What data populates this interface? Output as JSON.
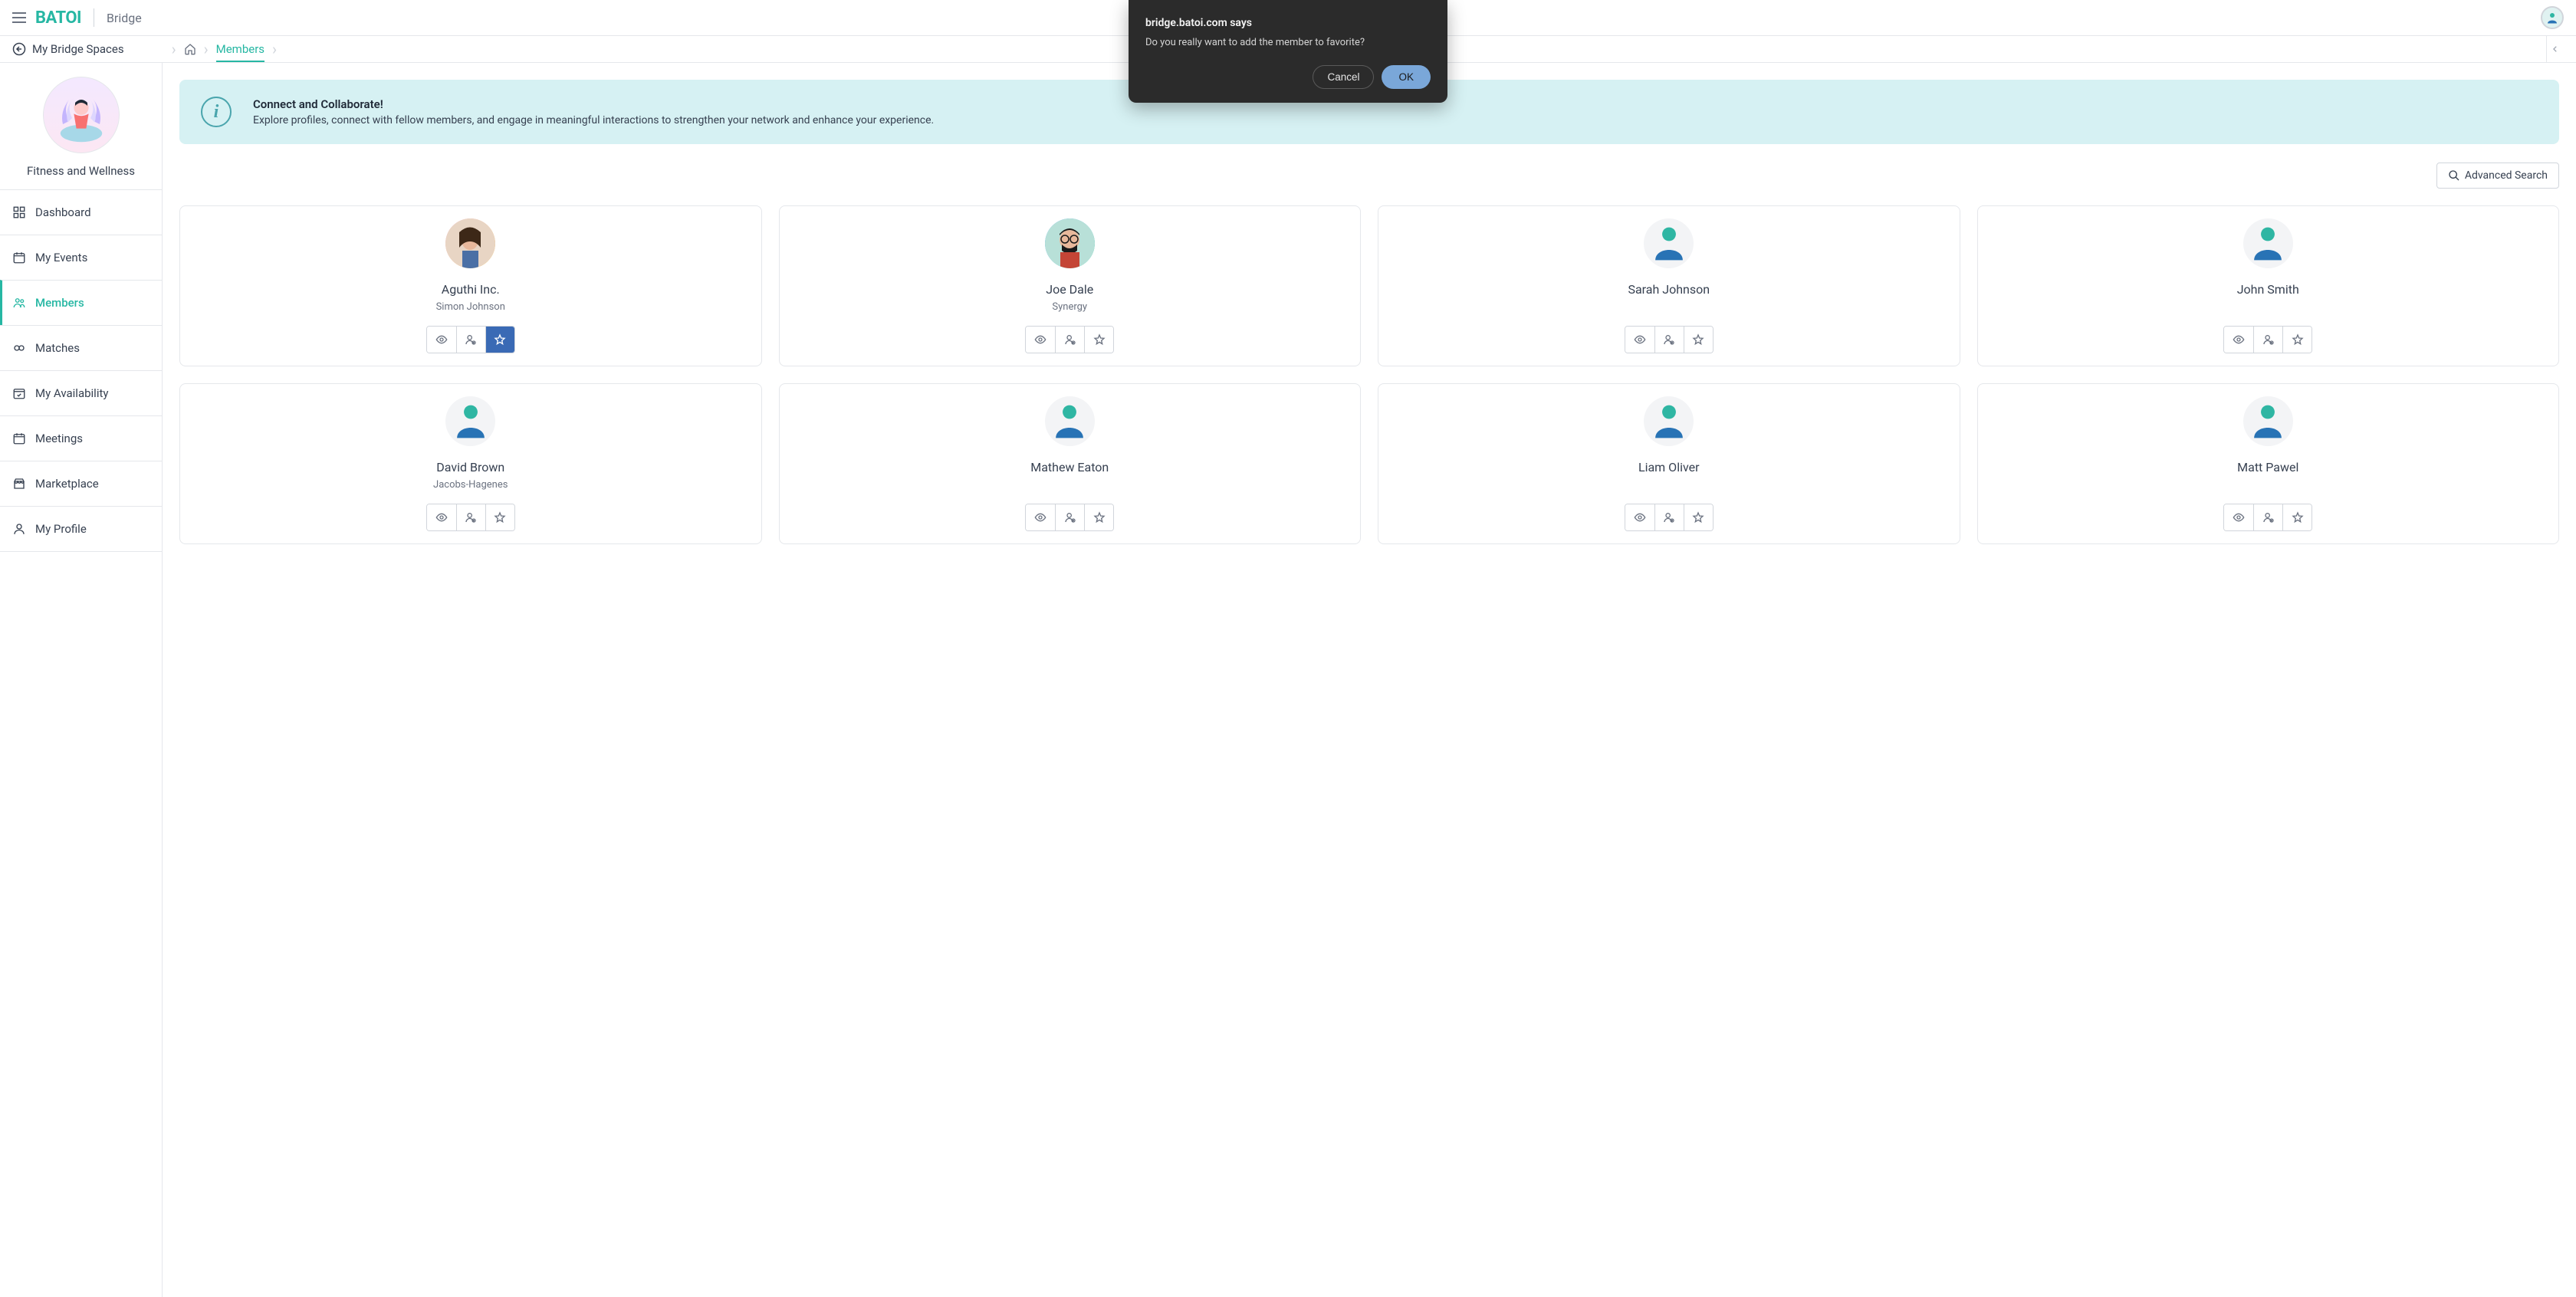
{
  "brand": {
    "name": "BATOI",
    "product": "Bridge"
  },
  "header": {
    "back_label": "My Bridge Spaces"
  },
  "breadcrumb": {
    "current": "Members"
  },
  "dialog": {
    "host": "bridge.batoi.com says",
    "message": "Do you really want to add the member to favorite?",
    "cancel": "Cancel",
    "ok": "OK"
  },
  "sidebar": {
    "space_name": "Fitness and Wellness",
    "items": [
      {
        "label": "Dashboard",
        "icon": "dashboard-icon"
      },
      {
        "label": "My Events",
        "icon": "calendar-icon"
      },
      {
        "label": "Members",
        "icon": "members-icon",
        "active": true
      },
      {
        "label": "Matches",
        "icon": "matches-icon"
      },
      {
        "label": "My Availability",
        "icon": "availability-icon"
      },
      {
        "label": "Meetings",
        "icon": "meetings-icon"
      },
      {
        "label": "Marketplace",
        "icon": "marketplace-icon"
      },
      {
        "label": "My Profile",
        "icon": "profile-icon"
      }
    ]
  },
  "banner": {
    "title": "Connect and Collaborate!",
    "text": "Explore profiles, connect with fellow members, and engage in meaningful interactions to strengthen your network and enhance your experience."
  },
  "search": {
    "advanced_label": "Advanced Search"
  },
  "members": [
    {
      "name": "Aguthi Inc.",
      "org": "Simon Johnson",
      "avatar": "photo1",
      "fav_active": true
    },
    {
      "name": "Joe Dale",
      "org": "Synergy",
      "avatar": "photo2",
      "fav_active": false
    },
    {
      "name": "Sarah Johnson",
      "org": "",
      "avatar": "generic",
      "fav_active": false
    },
    {
      "name": "John Smith",
      "org": "",
      "avatar": "generic",
      "fav_active": false
    },
    {
      "name": "David Brown",
      "org": "Jacobs-Hagenes",
      "avatar": "generic",
      "fav_active": false
    },
    {
      "name": "Mathew Eaton",
      "org": "",
      "avatar": "generic",
      "fav_active": false
    },
    {
      "name": "Liam Oliver",
      "org": "",
      "avatar": "generic",
      "fav_active": false
    },
    {
      "name": "Matt Pawel",
      "org": "",
      "avatar": "generic",
      "fav_active": false
    }
  ],
  "icon_labels": {
    "view": "view",
    "connect": "connect",
    "favorite": "favorite"
  }
}
